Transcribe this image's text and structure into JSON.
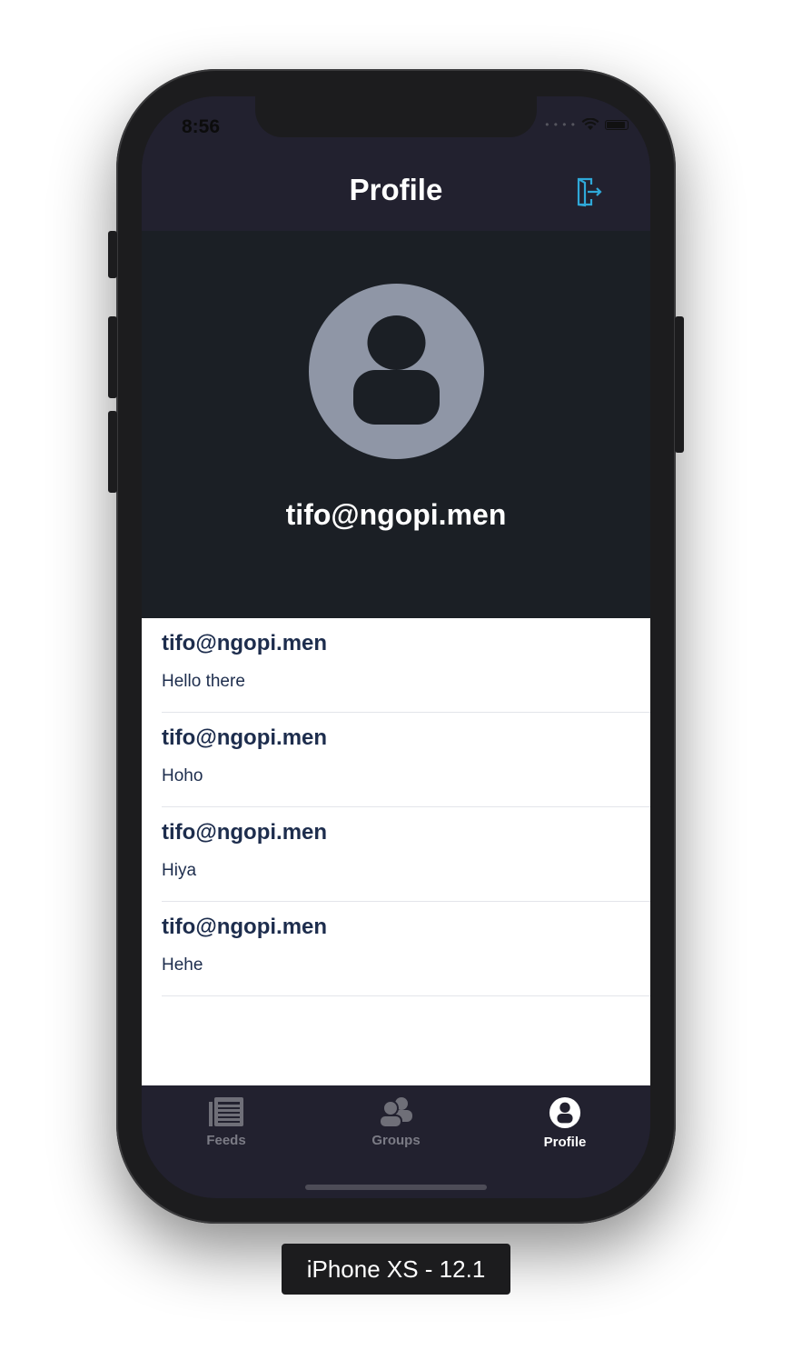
{
  "status_bar": {
    "time": "8:56"
  },
  "header": {
    "title": "Profile",
    "logout_icon": "logout-icon"
  },
  "profile": {
    "email": "tifo@ngopi.men",
    "avatar_icon": "user-avatar-icon"
  },
  "posts": [
    {
      "author": "tifo@ngopi.men",
      "text": "Hello there"
    },
    {
      "author": "tifo@ngopi.men",
      "text": "Hoho"
    },
    {
      "author": "tifo@ngopi.men",
      "text": "Hiya"
    },
    {
      "author": "tifo@ngopi.men",
      "text": "Hehe"
    }
  ],
  "tabs": [
    {
      "label": "Feeds",
      "icon": "feeds-icon",
      "active": false
    },
    {
      "label": "Groups",
      "icon": "groups-icon",
      "active": false
    },
    {
      "label": "Profile",
      "icon": "profile-icon",
      "active": true
    }
  ],
  "device_label": "iPhone XS - 12.1",
  "colors": {
    "accent": "#2fa8d8",
    "header_bg": "#22212f",
    "profile_bg": "#1b1f25",
    "text_dark": "#1d2d4d"
  }
}
